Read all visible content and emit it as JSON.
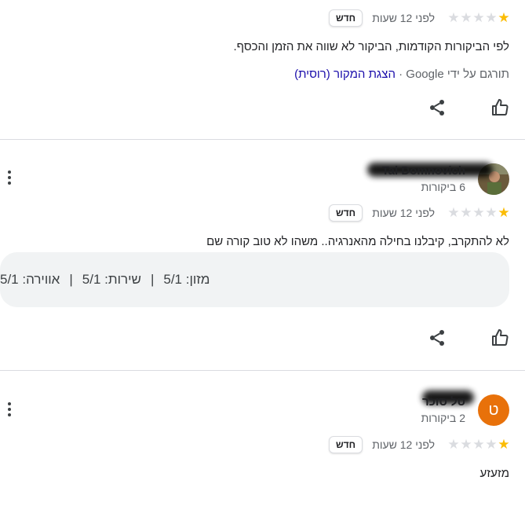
{
  "reviews": [
    {
      "stars": 1,
      "time": "לפני 12 שעות",
      "badge": "חדש",
      "text": "לפי הביקורות הקודמות, הביקור לא שווה את הזמן והכסף.",
      "translated_prefix": "תורגם על ידי Google ·",
      "translated_link": "הצגת המקור (רוסית)"
    },
    {
      "name": "Tal Domnovich",
      "reviews_count": "6 ביקורות",
      "stars": 1,
      "time": "לפני 12 שעות",
      "badge": "חדש",
      "text": "לא להתקרב, קיבלנו בחילה מהאנרגיה.. משהו לא טוב קורה שם",
      "ratings": {
        "food": "מזון: 5/1",
        "sep1": "|",
        "service": "שירות: 5/1",
        "sep2": "|",
        "atmosphere": "אווירה: 5/1"
      }
    },
    {
      "name": "טל סוכר",
      "avatar_letter": "ט",
      "reviews_count": "2 ביקורות",
      "stars": 1,
      "time": "לפני 12 שעות",
      "badge": "חדש",
      "text": "מזעזע"
    }
  ],
  "colors": {
    "star_on": "#fbbc04",
    "star_off": "#dadce0",
    "avatar_orange": "#e8710a",
    "link": "#1a0dab"
  },
  "icons": [
    "like-icon",
    "share-icon",
    "more-vert-icon",
    "star-icon"
  ]
}
